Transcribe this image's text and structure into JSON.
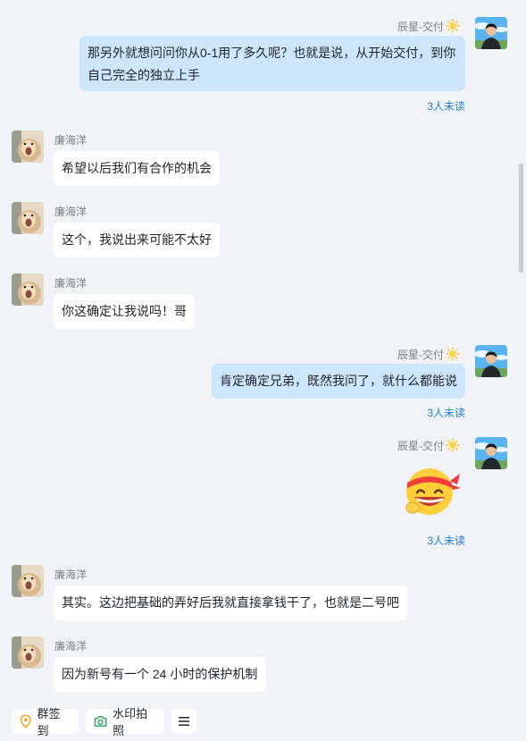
{
  "me": {
    "name": "辰星-交付"
  },
  "other": {
    "name": "廉海洋"
  },
  "messages": {
    "m1": {
      "text_line1": "那另外就想问问你从0-1用了多久呢？也就是说，从开始交付，到你",
      "text_line2": "自己完全的独立上手",
      "unread": "3人未读"
    },
    "m2": {
      "text": "希望以后我们有合作的机会"
    },
    "m3": {
      "text": "这个，我说出来可能不太好"
    },
    "m4": {
      "text": "你这确定让我说吗！哥"
    },
    "m5": {
      "text": "肯定确定兄弟，既然我问了，就什么都能说",
      "unread": "3人未读"
    },
    "m6": {
      "sticker": "grinning-headband-emoji",
      "unread": "3人未读"
    },
    "m7": {
      "text": "其实。这边把基础的弄好后我就直接拿钱干了，也就是二号吧"
    },
    "m8": {
      "text": "因为新号有一个 24 小时的保护机制"
    }
  },
  "toolbar": {
    "checkin_label": "群签到",
    "checkin_icon": "location-pin-icon",
    "camera_label": "水印拍照",
    "camera_icon": "camera-icon",
    "more_icon": "menu-icon"
  },
  "colors": {
    "background": "#f1f3f8",
    "my_bubble": "#cde6fb",
    "other_bubble": "#ffffff",
    "unread_text": "#1f7fd4"
  }
}
